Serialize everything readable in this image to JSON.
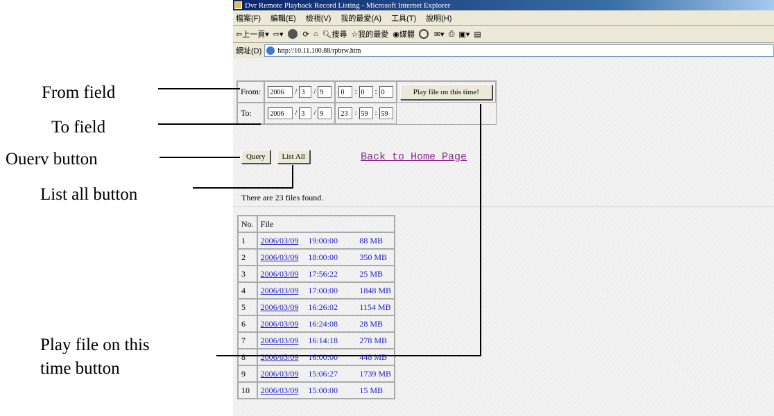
{
  "annotations": {
    "from_field": "From field",
    "to_field": "To field",
    "query_button": "Ouerv button",
    "list_all_button": "List all  button",
    "play_file_line1": "Play file on this",
    "play_file_line2": "time button"
  },
  "window": {
    "title": "Dvr Remote Playback Record Listing - Microsoft Internet Explorer"
  },
  "menu": [
    "檔案(F)",
    "編輯(E)",
    "檢視(V)",
    "我的最愛(A)",
    "工具(T)",
    "說明(H)"
  ],
  "toolbar": {
    "back": "上一頁",
    "search": "搜尋",
    "favorites": "我的最愛",
    "media": "媒體"
  },
  "address": {
    "label": "網址(D)",
    "url": "http://10.11.100.88/rpbrw.htm"
  },
  "form": {
    "from_label": "From:",
    "to_label": "To:",
    "from_year": "2006",
    "from_month": "3",
    "from_day": "9",
    "from_hour": "0",
    "from_min": "0",
    "from_sec": "0",
    "to_year": "2006",
    "to_month": "3",
    "to_day": "9",
    "to_hour": "23",
    "to_min": "59",
    "to_sec": "59",
    "date_sep": "/",
    "time_sep": ":",
    "play_button": "Play file on this time!"
  },
  "buttons": {
    "query": "Query",
    "list_all": "List All",
    "back_link": "Back to Home Page"
  },
  "status": "There are 23 files found.",
  "files": {
    "headers": [
      "No.",
      "File"
    ],
    "rows": [
      {
        "no": "1",
        "date": "2006/03/09",
        "time": "19:00:00",
        "size": "88 MB"
      },
      {
        "no": "2",
        "date": "2006/03/09",
        "time": "18:00:00",
        "size": "350 MB"
      },
      {
        "no": "3",
        "date": "2006/03/09",
        "time": "17:56:22",
        "size": "25 MB"
      },
      {
        "no": "4",
        "date": "2006/03/09",
        "time": "17:00:00",
        "size": "1848 MB"
      },
      {
        "no": "5",
        "date": "2006/03/09",
        "time": "16:26:02",
        "size": "1154 MB"
      },
      {
        "no": "6",
        "date": "2006/03/09",
        "time": "16:24:08",
        "size": "28 MB"
      },
      {
        "no": "7",
        "date": "2006/03/09",
        "time": "16:14:18",
        "size": "278 MB"
      },
      {
        "no": "8",
        "date": "2006/03/09",
        "time": "16:00:00",
        "size": "448 MB"
      },
      {
        "no": "9",
        "date": "2006/03/09",
        "time": "15:06:27",
        "size": "1739 MB"
      },
      {
        "no": "10",
        "date": "2006/03/09",
        "time": "15:00:00",
        "size": "15 MB"
      }
    ]
  }
}
